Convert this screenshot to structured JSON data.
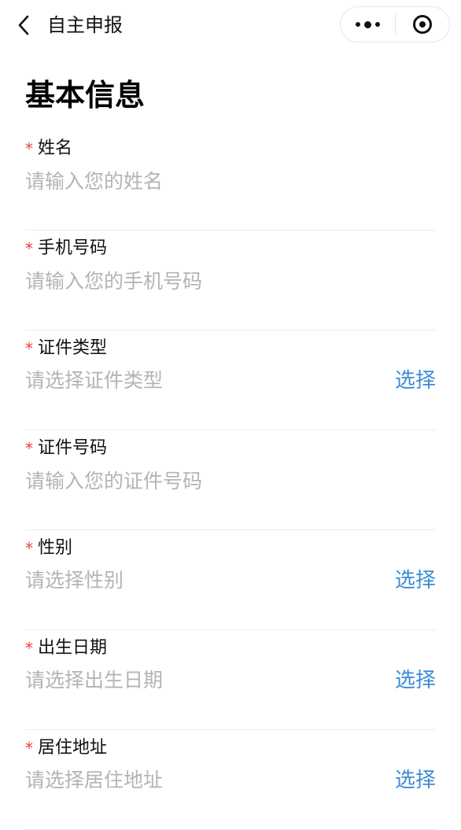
{
  "nav": {
    "title": "自主申报",
    "back_icon": "chevron-left-icon",
    "more_icon": "more-dots-icon",
    "close_icon": "target-circle-icon"
  },
  "section": {
    "title": "基本信息"
  },
  "colors": {
    "required": "#e64340",
    "placeholder": "#b4b4b4",
    "link": "#3d8bd9",
    "divider": "#ececec"
  },
  "form": {
    "name": {
      "required_mark": "*",
      "label": "姓名",
      "placeholder": "请输入您的姓名",
      "value": ""
    },
    "phone": {
      "required_mark": "*",
      "label": "手机号码",
      "placeholder": "请输入您的手机号码",
      "value": ""
    },
    "id_type": {
      "required_mark": "*",
      "label": "证件类型",
      "placeholder": "请选择证件类型",
      "action": "选择"
    },
    "id_number": {
      "required_mark": "*",
      "label": "证件号码",
      "placeholder": "请输入您的证件号码",
      "value": ""
    },
    "gender": {
      "required_mark": "*",
      "label": "性别",
      "placeholder": "请选择性别",
      "action": "选择"
    },
    "birth_date": {
      "required_mark": "*",
      "label": "出生日期",
      "placeholder": "请选择出生日期",
      "action": "选择"
    },
    "address": {
      "required_mark": "*",
      "label": "居住地址",
      "placeholder": "请选择居住地址",
      "action": "选择"
    }
  }
}
